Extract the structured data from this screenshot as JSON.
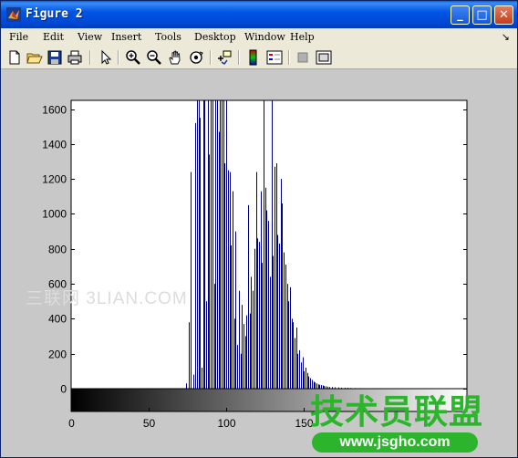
{
  "window": {
    "title": "Figure 2"
  },
  "title_buttons": {
    "minimize": "_",
    "maximize": "□",
    "close": "✕"
  },
  "menu": [
    {
      "label": "File"
    },
    {
      "label": "Edit"
    },
    {
      "label": "View"
    },
    {
      "label": "Insert"
    },
    {
      "label": "Tools"
    },
    {
      "label": "Desktop"
    },
    {
      "label": "Window"
    },
    {
      "label": "Help"
    }
  ],
  "menu_overflow": "↘",
  "toolbar": [
    "new-figure-icon",
    "open-file-icon",
    "save-icon",
    "print-icon",
    "edit-plot-arrow-icon",
    "zoom-in-icon",
    "zoom-out-icon",
    "pan-hand-icon",
    "rotate-3d-icon",
    "data-cursor-icon",
    "colorbar-icon",
    "legend-icon",
    "hide-plot-tools-icon",
    "show-plot-tools-icon"
  ],
  "watermarks": {
    "left": "三联网 3LIAN.COM",
    "right_cn": "技术员联盟",
    "right_url": "www.jsgho.com"
  },
  "chart_data": {
    "type": "bar",
    "description_style": "stem histogram of image intensities (imhist) with grayscale colorbar beneath",
    "xlim": [
      0,
      255
    ],
    "ylim": [
      0,
      1650
    ],
    "y_ticks": [
      0,
      200,
      400,
      600,
      800,
      1000,
      1200,
      1400,
      1600
    ],
    "x_ticks": [
      0,
      50,
      100,
      150
    ],
    "line_color": "#000080",
    "colorbar": "grayscale 0 (black) to 255 (white)",
    "x": [
      74,
      76,
      77,
      79,
      80,
      81,
      82,
      83,
      84,
      85,
      86,
      87,
      88,
      89,
      90,
      91,
      92,
      93,
      94,
      95,
      96,
      97,
      98,
      99,
      100,
      101,
      102,
      103,
      104,
      105,
      106,
      107,
      108,
      109,
      110,
      111,
      112,
      113,
      114,
      115,
      116,
      117,
      118,
      119,
      120,
      121,
      122,
      123,
      124,
      125,
      126,
      127,
      128,
      129,
      130,
      131,
      132,
      133,
      134,
      135,
      136,
      137,
      138,
      139,
      140,
      141,
      142,
      143,
      144,
      145,
      146,
      147,
      148,
      149,
      150,
      151,
      152,
      153,
      154,
      155,
      156,
      157,
      158,
      159,
      160,
      161,
      162,
      163,
      164,
      165,
      166,
      168,
      170,
      172,
      174,
      176,
      178,
      180,
      183,
      186,
      190,
      195,
      200,
      205,
      210,
      215,
      220
    ],
    "values": [
      30,
      380,
      1240,
      80,
      1520,
      1650,
      1650,
      1550,
      120,
      1650,
      1650,
      500,
      1650,
      1340,
      1650,
      1650,
      600,
      1650,
      1650,
      1470,
      1650,
      1650,
      1650,
      1290,
      1650,
      1250,
      1240,
      820,
      1130,
      400,
      900,
      250,
      560,
      200,
      480,
      370,
      300,
      420,
      1050,
      430,
      640,
      560,
      800,
      1240,
      860,
      840,
      1130,
      720,
      1650,
      1150,
      1020,
      960,
      640,
      1650,
      760,
      1270,
      1290,
      880,
      830,
      1200,
      1060,
      780,
      710,
      600,
      500,
      580,
      400,
      380,
      290,
      350,
      200,
      220,
      150,
      180,
      100,
      120,
      90,
      70,
      60,
      50,
      40,
      35,
      30,
      25,
      22,
      20,
      18,
      15,
      14,
      12,
      10,
      9,
      8,
      7,
      6,
      5,
      5,
      4,
      3,
      3,
      2,
      2,
      2,
      1,
      1,
      1,
      1
    ]
  }
}
